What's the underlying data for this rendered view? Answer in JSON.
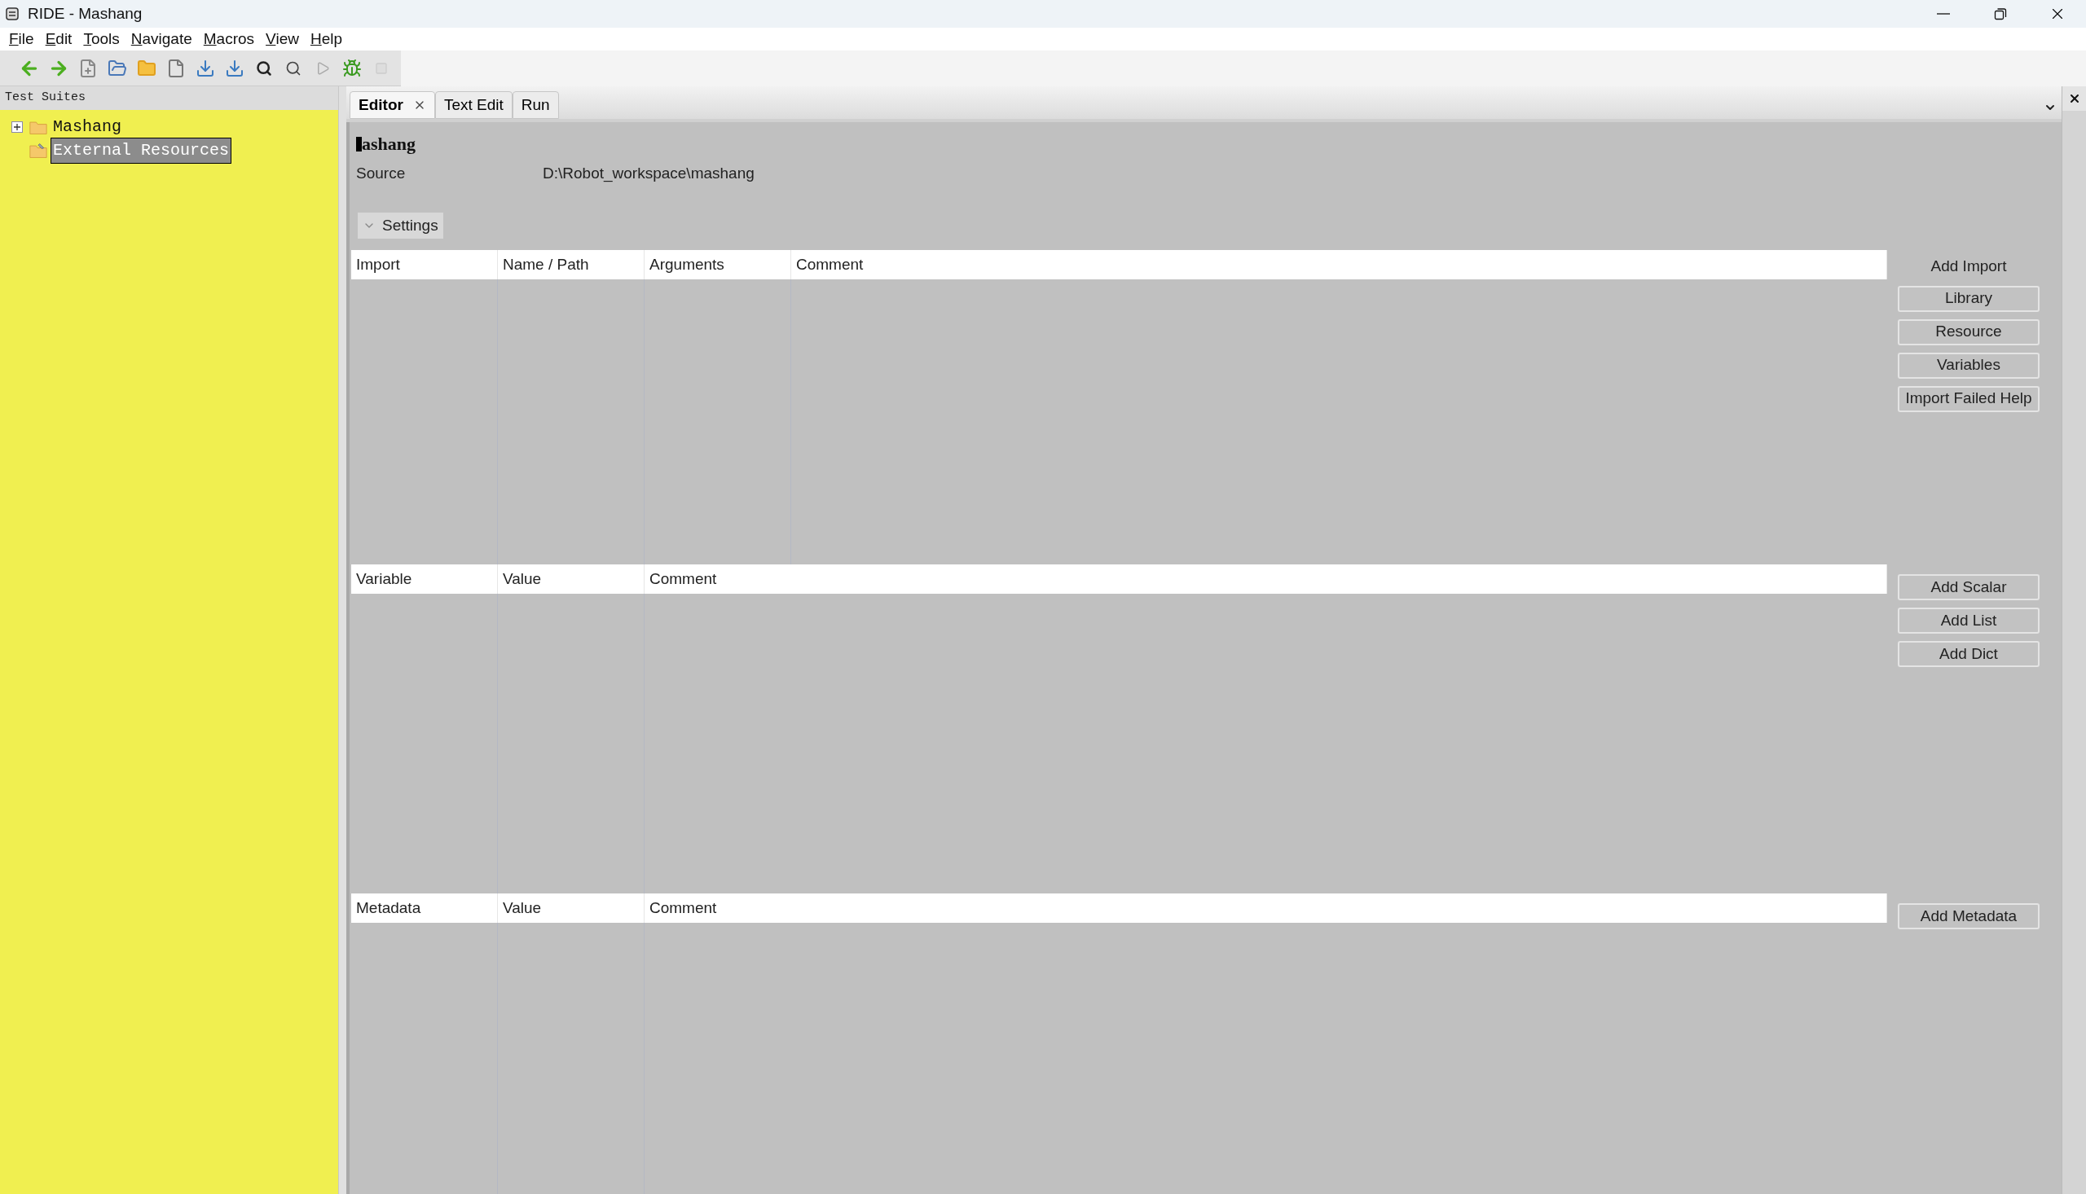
{
  "window": {
    "title": "RIDE - Mashang"
  },
  "menu": [
    "File",
    "Edit",
    "Tools",
    "Navigate",
    "Macros",
    "View",
    "Help"
  ],
  "tree": {
    "header": "Test Suites",
    "items": [
      {
        "label": "Mashang",
        "kind": "suite",
        "expanded": false,
        "selected": false
      },
      {
        "label": "External Resources",
        "kind": "resources",
        "selected": true
      }
    ]
  },
  "tabs": [
    {
      "label": "Editor",
      "selected": true
    },
    {
      "label": "Text Edit",
      "selected": false
    },
    {
      "label": "Run",
      "selected": false
    }
  ],
  "editor": {
    "title": "ashang",
    "source_label": "Source",
    "source": "D:\\Robot_workspace\\mashang",
    "settings_label": "Settings",
    "tables": [
      {
        "columns": [
          "Import",
          "Name / Path",
          "Arguments",
          "Comment"
        ],
        "heading": "Add Import",
        "buttons": [
          "Library",
          "Resource",
          "Variables",
          "Import Failed Help"
        ]
      },
      {
        "columns": [
          "Variable",
          "Value",
          "Comment"
        ],
        "buttons": [
          "Add Scalar",
          "Add List",
          "Add Dict"
        ]
      },
      {
        "columns": [
          "Metadata",
          "Value",
          "Comment"
        ],
        "buttons": [
          "Add Metadata"
        ]
      }
    ]
  }
}
